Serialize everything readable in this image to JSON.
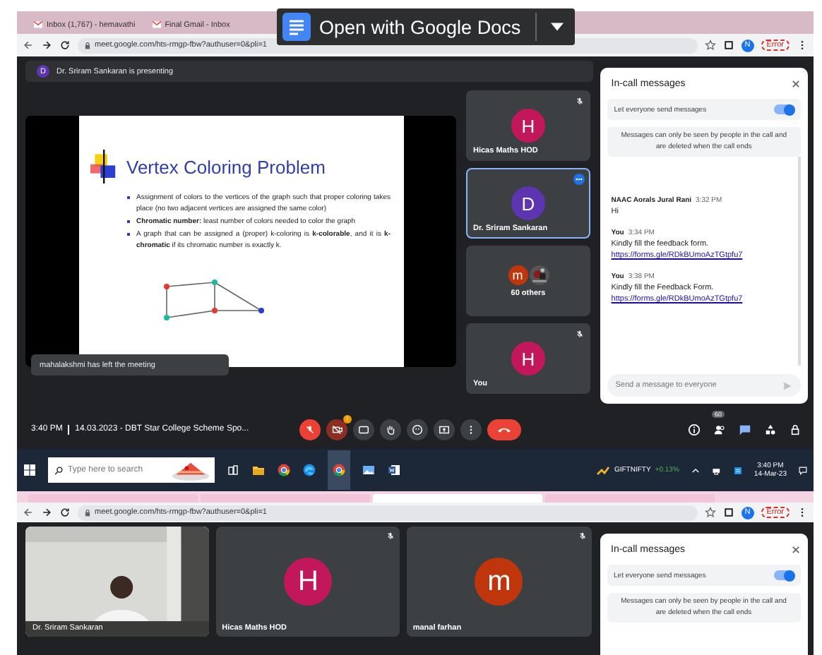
{
  "docs_banner": {
    "label": "Open with Google Docs"
  },
  "top_browser": {
    "tabs": [
      {
        "title": "Inbox (1,767) - hemavathi"
      },
      {
        "title": "Final Gmail - Inbox"
      }
    ],
    "url": "meet.google.com/hts-rmgp-fbw?authuser=0&pli=1",
    "avatar": "N",
    "profile": "Error"
  },
  "top_meet": {
    "presenting": {
      "initial": "D",
      "text": "Dr. Sriram Sankaran is presenting"
    },
    "slide": {
      "title": "Vertex Coloring Problem",
      "bullets": [
        "Assignment of colors to the vertices of the graph such that proper coloring takes place (no two adjacent vertices are assigned the same color)",
        "**Chromatic number:** least number of colors needed to color the graph",
        "A graph that can be assigned a (proper) k-coloring is **k-colorable**, and it is **k-chromatic** if its chromatic number is exactly k."
      ]
    },
    "toast": "mahalakshmi has left the meeting",
    "tiles": [
      {
        "kind": "avatar",
        "initial": "H",
        "name": "Hicas Maths HOD",
        "color": "#c2185b",
        "muted": true,
        "selected": false
      },
      {
        "kind": "avatar",
        "initial": "D",
        "name": "Dr. Sriram Sankaran",
        "color": "#5e35b1",
        "muted": false,
        "selected": true
      },
      {
        "kind": "group",
        "initial": "m",
        "name": "60 others",
        "color": "#bf360c",
        "muted": false,
        "selected": false
      },
      {
        "kind": "avatar",
        "initial": "H",
        "name": "You",
        "color": "#c2185b",
        "muted": true,
        "selected": false
      }
    ],
    "chat": {
      "title": "In-call messages",
      "toggle_label": "Let everyone send messages",
      "toggle_on": true,
      "notice": "Messages can only be seen by people in the call and are deleted when the call ends",
      "messages": [
        {
          "sender": "NAAC Aorals Jural Rani",
          "time": "3:32 PM",
          "lines": [
            {
              "kind": "text",
              "text": "Hi"
            }
          ]
        },
        {
          "sender": "You",
          "time": "3:34 PM",
          "lines": [
            {
              "kind": "text",
              "text": "Kindly fill the feedback form."
            },
            {
              "kind": "link",
              "text": "https://forms.gle/RDkBUmoAzTGtpfu7"
            }
          ]
        },
        {
          "sender": "You",
          "time": "3:38 PM",
          "lines": [
            {
              "kind": "text",
              "text": "Kindly fill the Feedback Form."
            },
            {
              "kind": "link",
              "text": "https://forms.gle/RDkBUmoAzTGtpfu7"
            }
          ]
        }
      ],
      "placeholder": "Send a message to everyone"
    },
    "bottom_bar": {
      "time": "3:40 PM",
      "meeting": "14.03.2023 - DBT Star College Scheme Spo...",
      "camera_alert": "!",
      "people_count": "60"
    }
  },
  "taskbar": {
    "search_placeholder": "Type here to search",
    "stock": "GIFTNIFTY",
    "change": "+0.13%",
    "time": "3:40 PM",
    "date": "14-Mar-23"
  },
  "bottom_browser": {
    "url": "meet.google.com/hts-rmgp-fbw?authuser=0&pli=1",
    "avatar": "N",
    "profile": "Error",
    "tabs": [
      {
        "selected": false
      },
      {
        "selected": false
      },
      {
        "selected": true
      },
      {
        "selected": false
      }
    ]
  },
  "bottom_meet": {
    "tiles": [
      {
        "kind": "video",
        "name": "Dr. Sriram Sankaran"
      },
      {
        "kind": "avatar",
        "initial": "H",
        "name": "Hicas Maths HOD",
        "color": "#c2185b",
        "muted": true
      },
      {
        "kind": "avatar",
        "initial": "m",
        "name": "manal farhan",
        "color": "#bf360c",
        "muted": true
      }
    ],
    "chat": {
      "title": "In-call messages",
      "toggle_label": "Let everyone send messages",
      "toggle_on": true,
      "notice": "Messages can only be seen by people in the call and are deleted when the call ends"
    }
  }
}
